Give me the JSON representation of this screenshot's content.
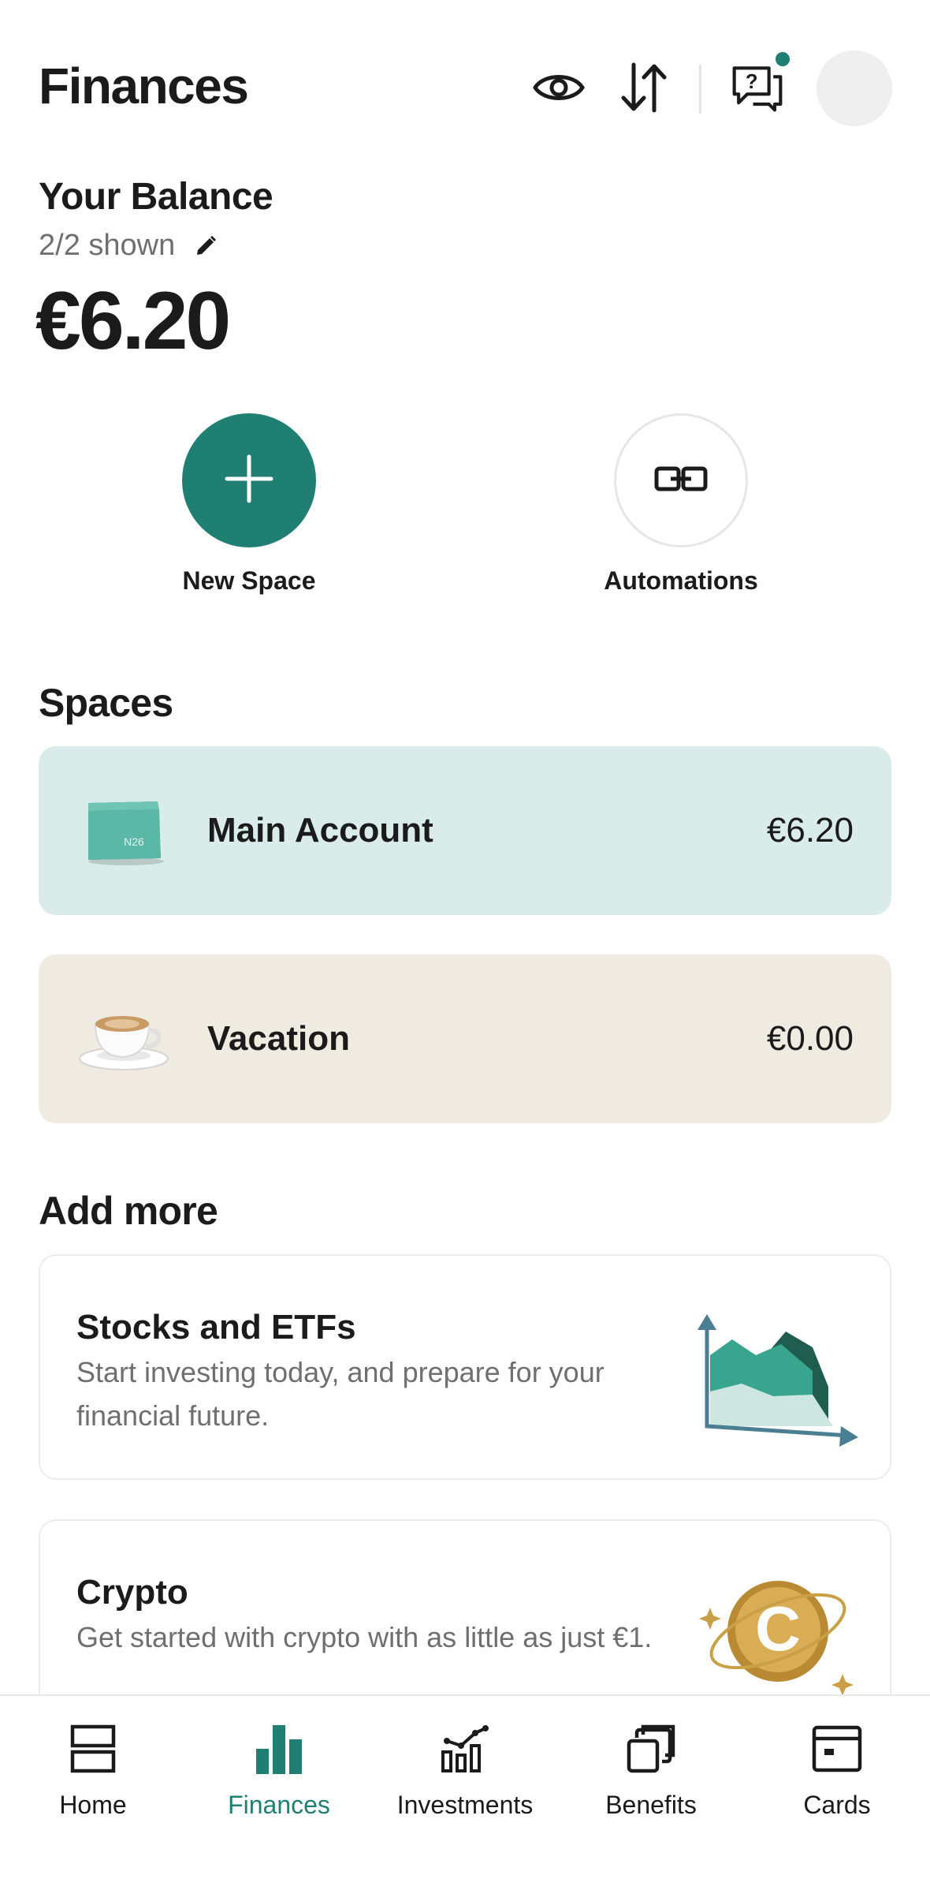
{
  "header": {
    "title": "Finances",
    "icons": [
      "eye-icon",
      "sort-arrows-icon",
      "help-chat-icon",
      "avatar"
    ]
  },
  "balance": {
    "title": "Your Balance",
    "shown": "2/2 shown",
    "amount": "€6.20"
  },
  "actions": [
    {
      "label": "New Space",
      "icon": "plus-icon"
    },
    {
      "label": "Automations",
      "icon": "link-icon"
    }
  ],
  "spaces": {
    "title": "Spaces",
    "items": [
      {
        "name": "Main Account",
        "amount": "€6.20",
        "color": "#d9ecea",
        "thumb_text": "N26"
      },
      {
        "name": "Vacation",
        "amount": "€0.00",
        "color": "#f0ebe1"
      }
    ]
  },
  "add_more": {
    "title": "Add more",
    "cards": [
      {
        "title": "Stocks and ETFs",
        "description": "Start investing today, and prepare for your financial future."
      },
      {
        "title": "Crypto",
        "description": "Get started with crypto with as little as just €1."
      }
    ]
  },
  "tabbar": {
    "active": "Finances",
    "accent": "#1f7f73",
    "tabs": [
      {
        "label": "Home",
        "icon": "home-icon"
      },
      {
        "label": "Finances",
        "icon": "bar-chart-icon"
      },
      {
        "label": "Investments",
        "icon": "investments-icon"
      },
      {
        "label": "Benefits",
        "icon": "benefits-icon"
      },
      {
        "label": "Cards",
        "icon": "card-icon"
      }
    ]
  }
}
